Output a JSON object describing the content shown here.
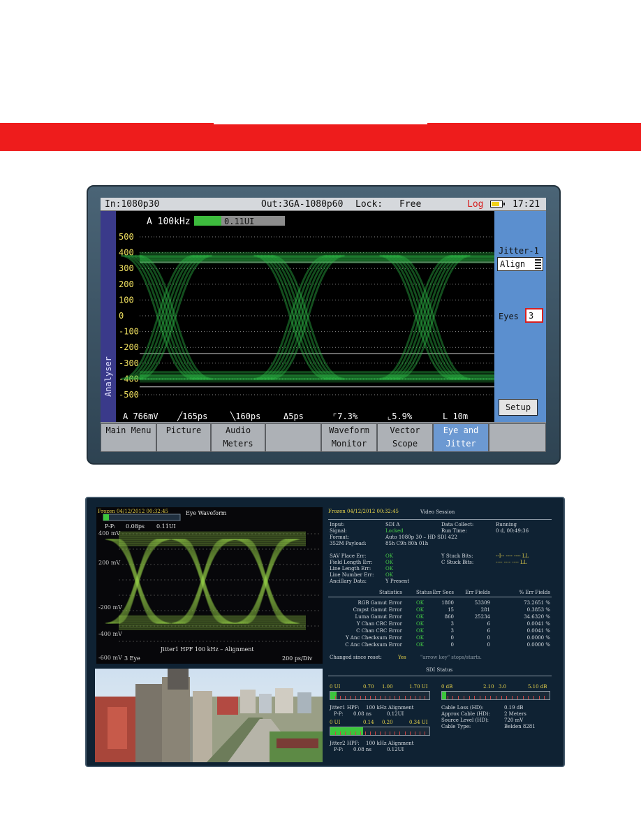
{
  "colors": {
    "banner": "#ee1c1c",
    "trace": "#2fbf4a",
    "panel": "#5b8fcf",
    "accent_red": "#d62020"
  },
  "screen1": {
    "status": {
      "input": "In:1080p30",
      "output": "Out:3GA-1080p60",
      "lock_label": "Lock:",
      "lock_value": "Free",
      "log": "Log",
      "time": "17:21",
      "battery_icon": "battery-icon"
    },
    "side_label": "Analyser",
    "meter": {
      "label": "A 100kHz",
      "value": "0.11UI",
      "fill_fraction": 0.3
    },
    "y_ticks": [
      "500",
      "400",
      "300",
      "200",
      "100",
      "0",
      "-100",
      "-200",
      "-300",
      "-400",
      "-500"
    ],
    "readouts": [
      "A 766mV",
      "╱165ps",
      "╲160ps",
      "Δ5ps",
      "⌜7.3%",
      "⌞5.9%",
      "L 10m"
    ],
    "right_panel": {
      "jitter_label": "Jitter-1",
      "align_value": "Align",
      "eyes_label": "Eyes",
      "eyes_value": "3",
      "setup_label": "Setup"
    },
    "menu": [
      {
        "line1": "Main Menu",
        "line2": ""
      },
      {
        "line1": "Picture",
        "line2": ""
      },
      {
        "line1": "Audio",
        "line2": "Meters"
      },
      {
        "line1": "",
        "line2": ""
      },
      {
        "line1": "Waveform",
        "line2": "Monitor"
      },
      {
        "line1": "Vector",
        "line2": "Scope"
      },
      {
        "line1": "Eye and",
        "line2": "Jitter",
        "selected": true
      },
      {
        "line1": "",
        "line2": ""
      }
    ]
  },
  "screen2": {
    "eye": {
      "frozen": "Frozen 04/12/2012 00:32:45",
      "title": "Eye Waveform",
      "pp_label": "P-P:",
      "pp_value": "0.08ps",
      "ui_value": "0.11UI",
      "y_labels": [
        "400 mV",
        "200 mV",
        "-200 mV",
        "-400 mV",
        "-600 mV"
      ],
      "footer": "Jitter1 HPF 100 kHz – Alignment",
      "eyes": "3 Eye",
      "scale": "200 ps/Div"
    },
    "session": {
      "frozen": "Frozen 04/12/2012 00:32:45",
      "title": "Video Session",
      "fields": [
        {
          "label": "Input:",
          "value": "SDI A"
        },
        {
          "label": "Signal:",
          "value": "Locked"
        },
        {
          "label": "Format:",
          "value": "Auto 1080p 30 – HD SDI 422"
        },
        {
          "label": "352M Payload:",
          "value": "85h C9h 80h 01h"
        }
      ],
      "fields_right": [
        {
          "label": "Data Collect:",
          "value": "Running"
        },
        {
          "label": "Run Time:",
          "value": "0 d, 00:49:36"
        }
      ],
      "errors": [
        {
          "label": "SAV Place Err:",
          "value": "OK"
        },
        {
          "label": "Field Length Err:",
          "value": "OK"
        },
        {
          "label": "Line Length Err:",
          "value": "OK"
        },
        {
          "label": "Line Number Err:",
          "value": "OK"
        },
        {
          "label": "Ancillary Data:",
          "value": "Y Present"
        }
      ],
      "stuck": [
        {
          "label": "Y Stuck Bits:",
          "value": "--I-- ---- ---- LL"
        },
        {
          "label": "C Stuck Bits:",
          "value": "---- ---- ---- LL"
        }
      ],
      "table": {
        "headers": [
          "Statistics",
          "Status",
          "Err Secs",
          "Err Fields",
          "% Err Fields"
        ],
        "rows": [
          [
            "RGB Gamut Error",
            "OK",
            "1800",
            "53309",
            "73.2651 %"
          ],
          [
            "Cmpst Gamut Error",
            "OK",
            "15",
            "281",
            "0.3853 %"
          ],
          [
            "Luma Gamut Error",
            "OK",
            "860",
            "25234",
            "34.6320 %"
          ],
          [
            "Y Chan CRC Error",
            "OK",
            "3",
            "6",
            "0.0041 %"
          ],
          [
            "C Chan CRC Error",
            "OK",
            "3",
            "6",
            "0.0041 %"
          ],
          [
            "Y Anc Checksum Error",
            "OK",
            "0",
            "0",
            "0.0000 %"
          ],
          [
            "C Anc Checksum Error",
            "OK",
            "0",
            "0",
            "0.0000 %"
          ]
        ]
      },
      "changed_label": "Changed since reset:",
      "changed_value": "Yes",
      "arrow_hint": "\"arrow key\" stops/starts.",
      "sdi_title": "SDI Status",
      "jitter1_scale": [
        "0 UI",
        "0.70",
        "1.00",
        "1.70 UI"
      ],
      "jitter1_fill": 0.06,
      "jitter1": {
        "label": "Jitter1 HPF:",
        "value": "100 kHz Alignment",
        "pp_label": "P-P:",
        "pp": "0.08 ns",
        "ui": "0.12UI"
      },
      "jitter2_scale": [
        "0 UI",
        "0.14",
        "0.20",
        "0.34 UI"
      ],
      "jitter2_fill": 0.33,
      "jitter2": {
        "label": "Jitter2 HPF:",
        "value": "100 kHz Alignment",
        "pp_label": "P-P:",
        "pp": "0.08 ns",
        "ui": "0.12UI"
      },
      "cable_scale": [
        "0 dB",
        "2.10",
        "3.0",
        "5.10 dB"
      ],
      "cable_fill": 0.04,
      "cable": [
        {
          "label": "Cable Loss (HD):",
          "value": "0.19 dB"
        },
        {
          "label": "Approx Cable (HD):",
          "value": "2 Meters"
        },
        {
          "label": "Source Level (HD):",
          "value": "720 mV"
        },
        {
          "label": "Cable Type:",
          "value": "Belden 8281"
        }
      ]
    }
  }
}
